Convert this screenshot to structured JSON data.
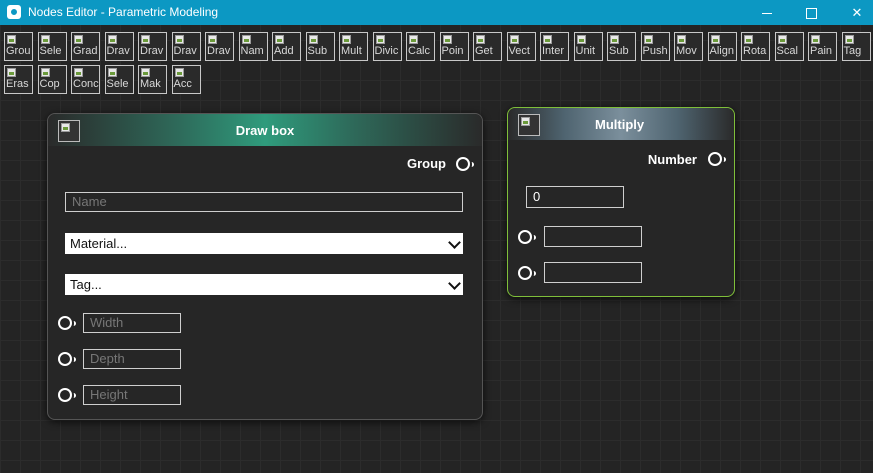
{
  "window": {
    "title": "Nodes Editor - Parametric Modeling",
    "buttons": {
      "minimize": "minimize",
      "maximize": "maximize",
      "close": "✕"
    }
  },
  "toolbar": {
    "row1": [
      "Grou",
      "Sele",
      "Grad",
      "Drav",
      "Drav",
      "Drav",
      "Drav",
      "Nam",
      "Add",
      "Sub",
      "Mult",
      "Divic",
      "Calc",
      "Poin",
      "Get",
      "Vect",
      "Inter",
      "Unit",
      "Sub",
      "Push",
      "Mov",
      "Align",
      "Rota",
      "Scal",
      "Pain",
      "Tag"
    ],
    "row2": [
      "Eras",
      "Cop",
      "Conc",
      "Sele",
      "Mak",
      "Acc"
    ]
  },
  "nodes": {
    "draw_box": {
      "title": "Draw box",
      "output_label": "Group",
      "name_placeholder": "Name",
      "material_select": "Material...",
      "tag_select": "Tag...",
      "width_placeholder": "Width",
      "depth_placeholder": "Depth",
      "height_placeholder": "Height"
    },
    "multiply": {
      "title": "Multiply",
      "output_label": "Number",
      "value": "0",
      "input_a": "",
      "input_b": ""
    }
  },
  "colors": {
    "titlebar": "#0c98c3",
    "draw_box_header": "#2f9b7c",
    "multiply_header": "#6f8593",
    "multiply_border": "#7fbf3a"
  }
}
